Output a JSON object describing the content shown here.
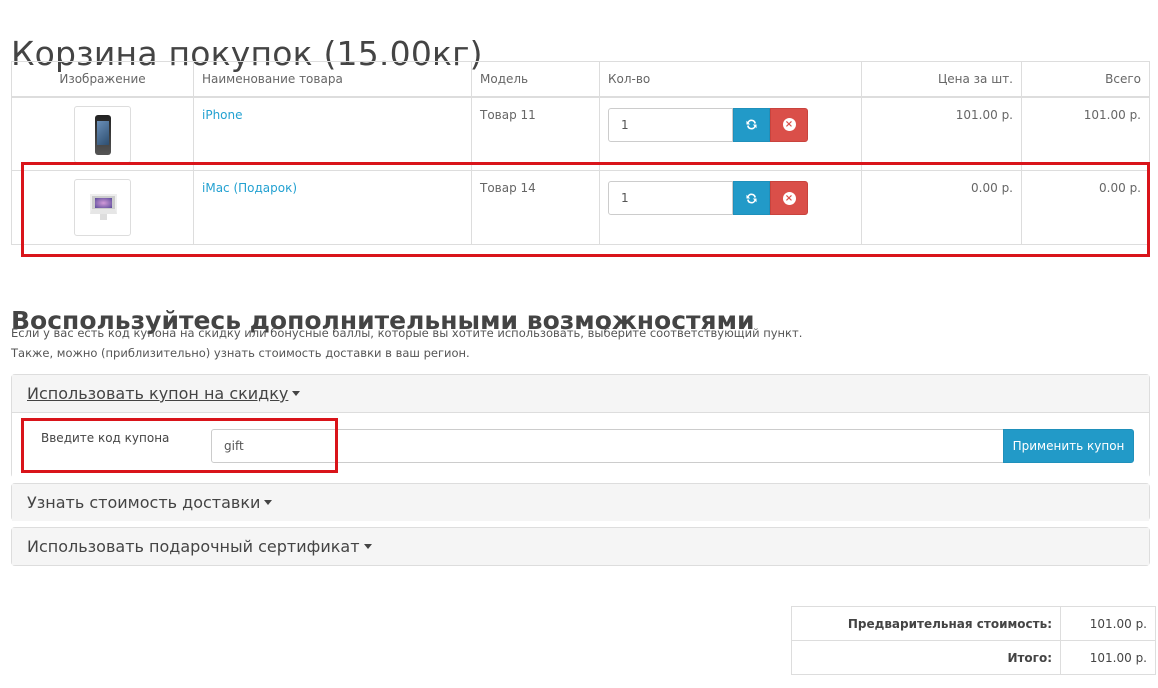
{
  "page": {
    "title": "Корзина покупок  (15.00кг)"
  },
  "cart": {
    "headers": {
      "image": "Изображение",
      "name": "Наименование товара",
      "model": "Модель",
      "qty": "Кол-во",
      "unit_price": "Цена за шт.",
      "total": "Всего"
    },
    "rows": [
      {
        "image_icon": "iphone-image",
        "name": "iPhone",
        "model": "Товар 11",
        "qty": "1",
        "unit_price": "101.00 р.",
        "total": "101.00 р."
      },
      {
        "image_icon": "imac-image",
        "name": "iMac (Подарок)",
        "model": "Товар 14",
        "qty": "1",
        "unit_price": "0.00 р.",
        "total": "0.00 р."
      }
    ]
  },
  "extras": {
    "title": "Воспользуйтесь дополнительными возможностями",
    "line1": "Если у вас есть код купона на скидку или бонусные баллы, которые вы хотите использовать, выберите соответствующий пункт.",
    "line2": "Также, можно (приблизительно) узнать стоимость доставки в ваш регион.",
    "coupon": {
      "heading": "Использовать купон на скидку",
      "label": "Введите код купона",
      "value": "gift",
      "button": "Применить купон"
    },
    "shipping": {
      "heading": "Узнать стоимость доставки"
    },
    "voucher": {
      "heading": "Использовать подарочный сертификат"
    }
  },
  "totals": {
    "rows": [
      {
        "label": "Предварительная стоимость:",
        "value": "101.00 р."
      },
      {
        "label": "Итого:",
        "value": "101.00 р."
      }
    ]
  },
  "colors": {
    "accent": "#229ac8",
    "danger": "#da4f49",
    "highlight": "#d9141a",
    "link": "#23a1d1"
  }
}
